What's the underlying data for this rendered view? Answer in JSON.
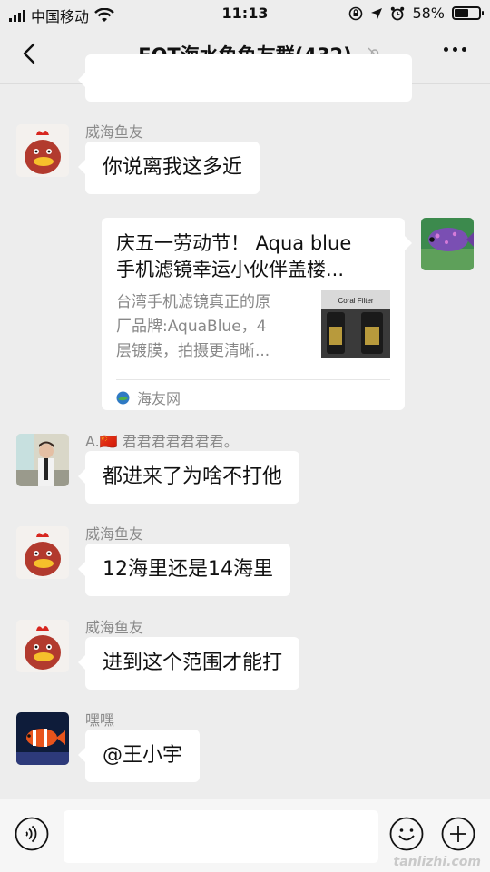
{
  "status_bar": {
    "carrier": "中国移动",
    "time": "11:13",
    "battery_text": "58%",
    "battery_level": 0.58,
    "icons": [
      "signal-icon",
      "wifi-icon",
      "rotation-lock-icon",
      "location-icon",
      "alarm-icon",
      "battery-icon"
    ]
  },
  "nav": {
    "title": "FOT海水鱼鱼友群(432)",
    "icons": [
      "back-icon",
      "mute-icon",
      "more-icon"
    ]
  },
  "messages": [
    {
      "sender": "威海鱼友",
      "text": "你说离我这多近",
      "avatar": "chicken-avatar"
    },
    {
      "type": "link",
      "title_lines": [
        "庆五一劳动节！ Aqua blue",
        "手机滤镜幸运小伙伴盖楼..."
      ],
      "desc_lines": [
        "台湾手机滤镜真正的原",
        "厂品牌:AquaBlue，4",
        "层镀膜，拍摄更清晰..."
      ],
      "thumb_text": "Coral Filter",
      "source": "海友网",
      "avatar": "fish-avatar"
    },
    {
      "sender": "A.🇨🇳 君君君君君君君。",
      "text": "都进来了为啥不打他",
      "avatar": "person-avatar"
    },
    {
      "sender": "威海鱼友",
      "text": "12海里还是14海里",
      "avatar": "chicken-avatar"
    },
    {
      "sender": "威海鱼友",
      "text": "进到这个范围才能打",
      "avatar": "chicken-avatar"
    },
    {
      "sender": "嘿嘿",
      "text": "@王小宇",
      "avatar": "clownfish-avatar"
    }
  ],
  "input_bar": {
    "placeholder": "",
    "icons": [
      "voice-icon",
      "emoji-icon",
      "plus-icon"
    ]
  },
  "watermark": "tanlizhi.com"
}
